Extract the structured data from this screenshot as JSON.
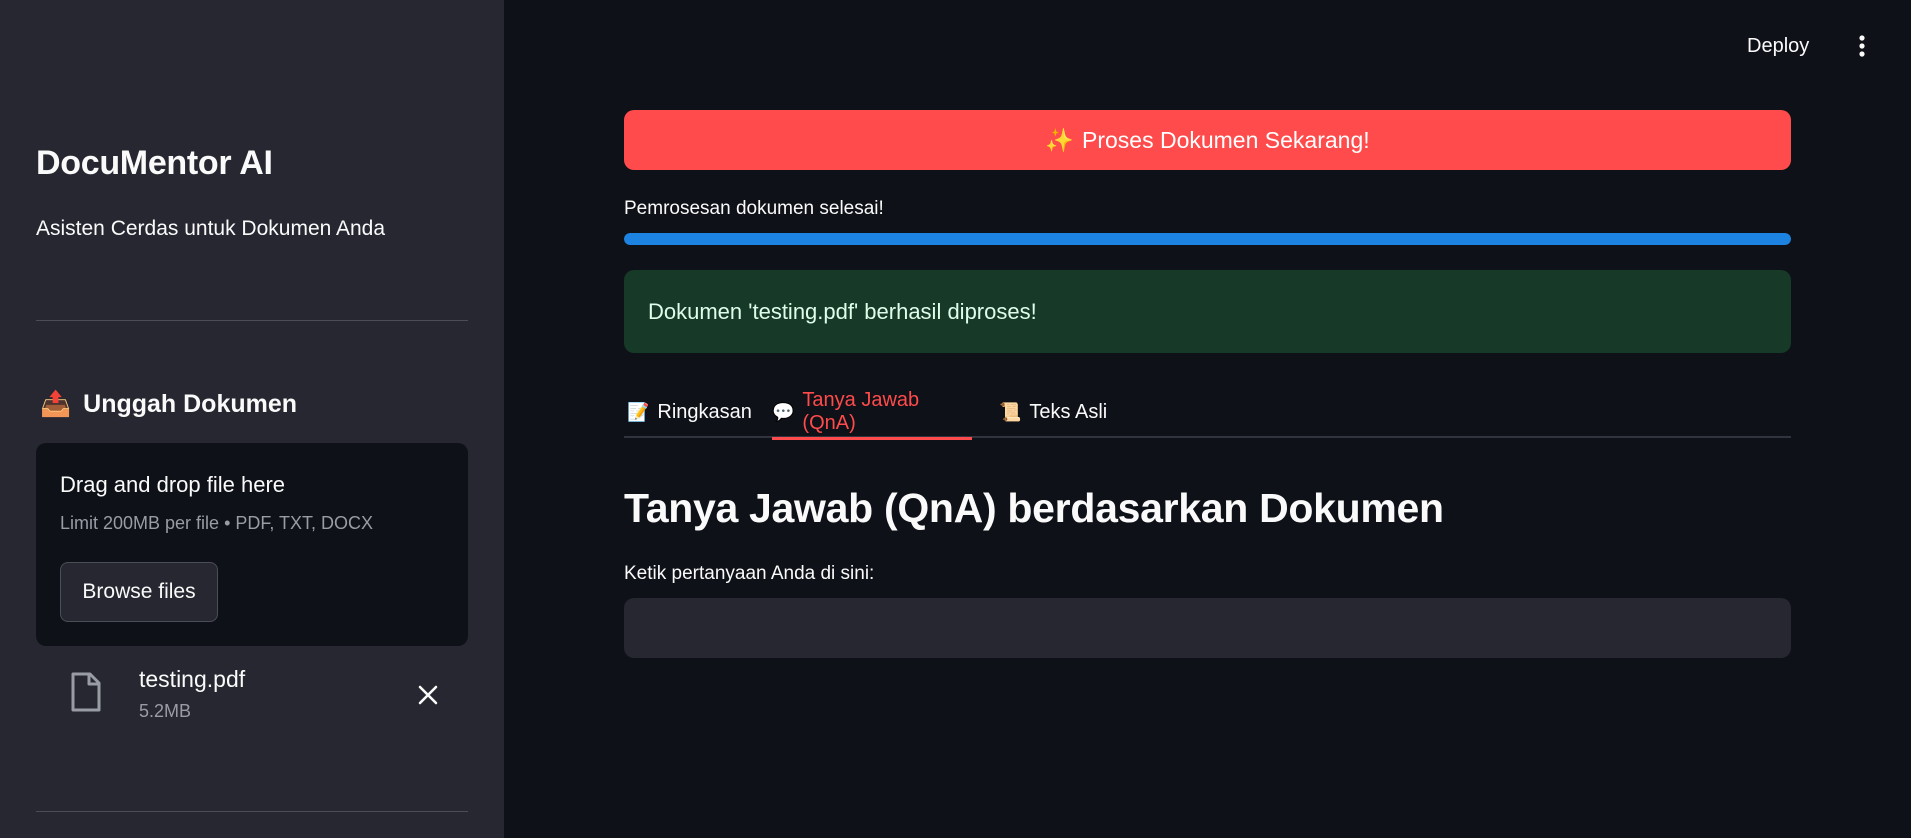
{
  "header": {
    "deploy_label": "Deploy",
    "menu_icon": "kebab-menu-icon"
  },
  "sidebar": {
    "title": "DocuMentor AI",
    "subtitle": "Asisten Cerdas untuk Dokumen Anda",
    "upload_section": {
      "emoji": "📤",
      "title": "Unggah Dokumen"
    },
    "uploader": {
      "drop_text": "Drag and drop file here",
      "limit_text": "Limit 200MB per file • PDF, TXT, DOCX",
      "browse_label": "Browse files"
    },
    "uploaded_file": {
      "icon": "file-icon",
      "name": "testing.pdf",
      "size": "5.2MB",
      "remove_icon": "close-icon"
    }
  },
  "main": {
    "process_button": {
      "emoji": "✨",
      "label": "Proses Dokumen Sekarang!"
    },
    "progress": {
      "label": "Pemrosesan dokumen selesai!",
      "value_percent": 100
    },
    "success_message": "Dokumen 'testing.pdf' berhasil diproses!",
    "tabs": [
      {
        "emoji": "📝",
        "label": "Ringkasan",
        "active": false
      },
      {
        "emoji": "💬",
        "label": "Tanya Jawab (QnA)",
        "active": true
      },
      {
        "emoji": "📜",
        "label": "Teks Asli",
        "active": false
      }
    ],
    "qna": {
      "heading": "Tanya Jawab (QnA) berdasarkan Dokumen",
      "input_label": "Ketik pertanyaan Anda di sini:",
      "input_value": "",
      "input_placeholder": ""
    }
  },
  "colors": {
    "background": "#0e1117",
    "sidebar": "#262730",
    "accent": "#ff4b4b",
    "progress": "#1c83e1",
    "success_bg": "#173928",
    "text": "#fafafa"
  }
}
